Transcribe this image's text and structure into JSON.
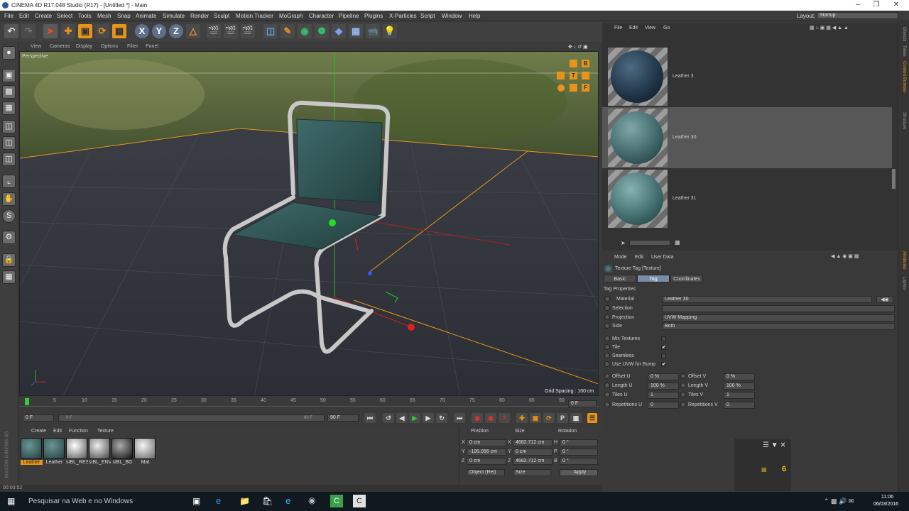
{
  "window": {
    "title": "CINEMA 4D R17.048 Studio (R17) - [Untitled *] - Main",
    "controls": [
      "–",
      "❒",
      "✕"
    ]
  },
  "menubar": {
    "items": [
      "File",
      "Edit",
      "Create",
      "Select",
      "Tools",
      "Mesh",
      "Snap",
      "Animate",
      "Simulate",
      "Render",
      "Sculpt",
      "Motion Tracker",
      "MoGraph",
      "Character",
      "Pipeline",
      "Plugins",
      "X-Particles",
      "Script",
      "Window",
      "Help"
    ],
    "layout_label": "Layout:",
    "layout_value": "Startup"
  },
  "toolbar": {
    "axis_x": "X",
    "axis_y": "Y",
    "axis_z": "Z"
  },
  "viewport": {
    "menu": [
      "View",
      "Cameras",
      "Display",
      "Options",
      "Filter",
      "Panel"
    ],
    "name": "Perspective",
    "grid_spacing": "Grid Spacing : 100 cm",
    "nav_letters": [
      "B",
      "T",
      "F"
    ]
  },
  "timeline": {
    "ticks": [
      "0",
      "5",
      "10",
      "15",
      "20",
      "25",
      "30",
      "35",
      "40",
      "45",
      "50",
      "55",
      "60",
      "65",
      "70",
      "75",
      "80",
      "85",
      "90"
    ],
    "end_marker": "0 F",
    "current_frame": "0 F",
    "start_field": "0 F",
    "range_left": "0 F",
    "range_right": "90 F",
    "end_field": "90 F"
  },
  "material_manager": {
    "menu": [
      "Create",
      "Edit",
      "Function",
      "Texture"
    ],
    "materials": [
      "Leather",
      "Leather",
      "sIBL_RES",
      "sIBL_ENV",
      "sIBL_BG",
      "Mat"
    ],
    "brand": "MAXON CINEMA 4D"
  },
  "coordinates": {
    "headers": [
      "Position",
      "Size",
      "Rotation"
    ],
    "rows": [
      {
        "axis": "X",
        "pos": "0 cm",
        "size_axis": "X",
        "size": "4682.712 cm",
        "rot_axis": "H",
        "rot": "0 °"
      },
      {
        "axis": "Y",
        "pos": "-195.056 cm",
        "size_axis": "Y",
        "size": "0 cm",
        "rot_axis": "P",
        "rot": "0 °"
      },
      {
        "axis": "Z",
        "pos": "0 cm",
        "size_axis": "Z",
        "size": "4682.712 cm",
        "rot_axis": "B",
        "rot": "0 °"
      }
    ],
    "mode": "Object (Rel)",
    "size_mode": "Size",
    "apply": "Apply"
  },
  "status": {
    "time": "00:00:52"
  },
  "content_browser": {
    "menu": [
      "File",
      "Edit",
      "View",
      "Go"
    ],
    "items": [
      {
        "label": "Leather 3",
        "color": "#1f3345",
        "selected": false
      },
      {
        "label": "Leather 30",
        "color": "#3d6367",
        "selected": true
      },
      {
        "label": "Leather 31",
        "color": "#3f6a6b",
        "selected": false
      }
    ]
  },
  "attributes": {
    "menu": [
      "Mode",
      "Edit",
      "User Data"
    ],
    "object_title": "Texture Tag [Texture]",
    "tabs": [
      {
        "label": "Basic",
        "active": false
      },
      {
        "label": "Tag",
        "active": true
      },
      {
        "label": "Coordinates",
        "active": false
      }
    ],
    "section": "Tag Properties",
    "props": [
      {
        "label": "Material",
        "value": "Leather 30"
      },
      {
        "label": "Selection",
        "value": ""
      },
      {
        "label": "Projection",
        "value": "UVW Mapping"
      },
      {
        "label": "Side",
        "value": "Both"
      }
    ],
    "checks": [
      {
        "label": "Mix Textures",
        "checked": ""
      },
      {
        "label": "Tile",
        "checked": "✔"
      },
      {
        "label": "Seamless",
        "checked": ""
      },
      {
        "label": "Use UVW for Bump",
        "checked": "✔"
      }
    ],
    "pairs": [
      {
        "l1": "Offset U",
        "v1": "0 %",
        "l2": "Offset V",
        "v2": "0 %"
      },
      {
        "l1": "Length U",
        "v1": "100 %",
        "l2": "Length V",
        "v2": "100 %"
      },
      {
        "l1": "Tiles U",
        "v1": "1",
        "l2": "Tiles V",
        "v2": "1"
      },
      {
        "l1": "Repetitions U",
        "v1": "0",
        "l2": "Repetitions V",
        "v2": "0"
      }
    ]
  },
  "right_strip": [
    "Objects",
    "Takes",
    "Content Browser",
    "Structure",
    "Attributes",
    "Layers"
  ],
  "hud": {
    "count": "6"
  },
  "taskbar": {
    "search_placeholder": "Pesquisar na Web e no Windows",
    "time": "11:06",
    "date": "06/03/2016"
  },
  "colors": {
    "accent_orange": "#e8941a",
    "selection_blue": "#7a8ca6",
    "taskbar": "#101820"
  }
}
